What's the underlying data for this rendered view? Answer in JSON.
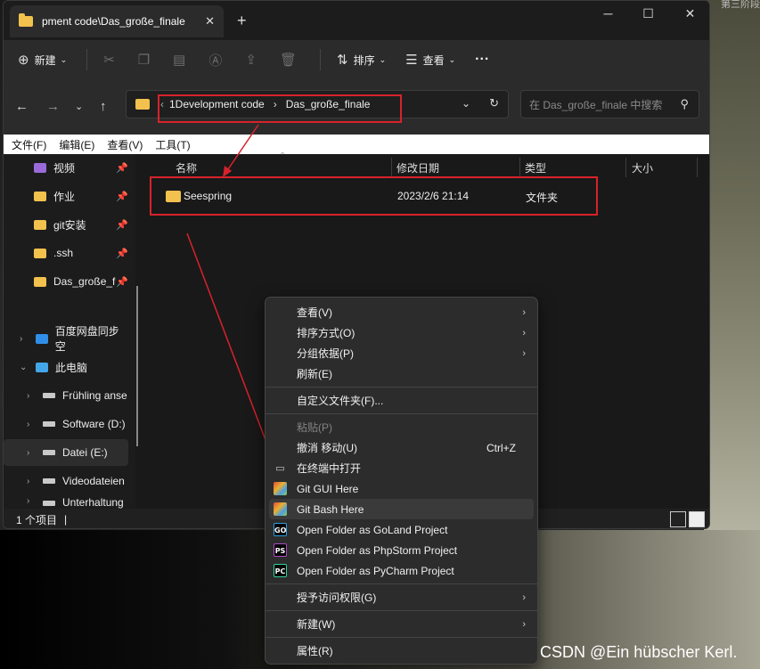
{
  "corner_text": "第三阶段",
  "window": {
    "tab_title": "pment code\\Das_große_finale",
    "tab_close": "✕",
    "new_tab": "+",
    "minimize": "─",
    "maximize": "☐",
    "close": "✕"
  },
  "toolbar": {
    "new_label": "新建",
    "sort_label": "排序",
    "view_label": "查看",
    "more_label": "···"
  },
  "address": {
    "crumbs": [
      "1Development code",
      "Das_große_finale"
    ],
    "lead": "‹",
    "search_placeholder": "在 Das_große_finale 中搜索"
  },
  "menubar": [
    "文件(F)",
    "编辑(E)",
    "查看(V)",
    "工具(T)"
  ],
  "sidebar": {
    "pinned": [
      {
        "label": "视频"
      },
      {
        "label": "作业"
      },
      {
        "label": "git安装"
      },
      {
        "label": ".ssh"
      },
      {
        "label": "Das_große_f"
      }
    ],
    "tree": [
      {
        "label": "百度网盘同步空"
      },
      {
        "label": "此电脑"
      },
      {
        "label": "Frühling anse"
      },
      {
        "label": "Software (D:)"
      },
      {
        "label": "Datei (E:)"
      },
      {
        "label": "Videodateien"
      },
      {
        "label": "Unterhaltung"
      }
    ]
  },
  "file_list": {
    "columns": [
      "名称",
      "修改日期",
      "类型",
      "大小"
    ],
    "rows": [
      {
        "name": "Seespring",
        "modified": "2023/2/6 21:14",
        "type": "文件夹"
      }
    ]
  },
  "status": {
    "count": "1 个项目",
    "sep": "|"
  },
  "context_menu": {
    "items": [
      {
        "label": "查看(V)"
      },
      {
        "label": "排序方式(O)"
      },
      {
        "label": "分组依据(P)"
      },
      {
        "label": "刷新(E)"
      },
      {
        "label": "自定义文件夹(F)..."
      },
      {
        "label": "粘贴(P)"
      },
      {
        "label": "撤消 移动(U)",
        "shortcut": "Ctrl+Z"
      },
      {
        "label": "在终端中打开"
      },
      {
        "label": "Git GUI Here"
      },
      {
        "label": "Git Bash Here"
      },
      {
        "label": "Open Folder as GoLand Project"
      },
      {
        "label": "Open Folder as PhpStorm Project"
      },
      {
        "label": "Open Folder as PyCharm Project"
      },
      {
        "label": "授予访问权限(G)"
      },
      {
        "label": "新建(W)"
      },
      {
        "label": "属性(R)"
      }
    ],
    "icon_text": {
      "goland": "GO",
      "php": "PS",
      "py": "PC"
    }
  },
  "watermark": "CSDN @Ein hübscher Kerl.",
  "colors": {
    "annotation_red": "#d7222b",
    "folder": "#f2c14e",
    "window_bg": "#202020"
  }
}
